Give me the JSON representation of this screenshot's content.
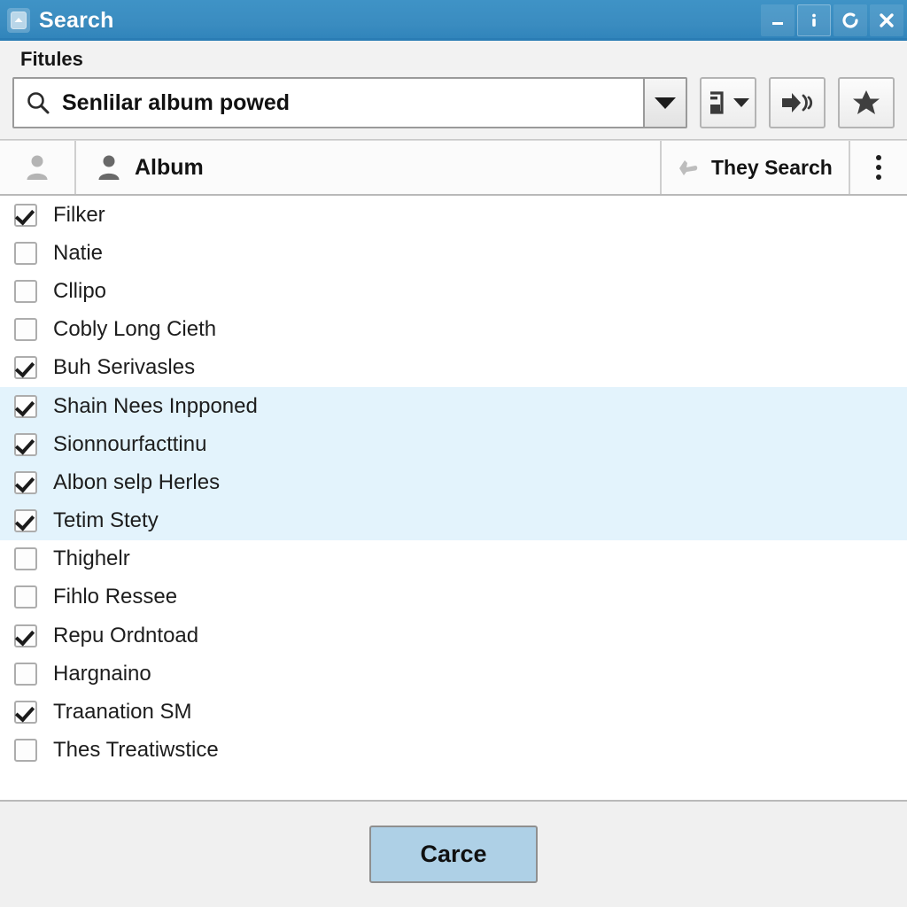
{
  "titlebar": {
    "app_icon": "chevron-up-app-icon",
    "title": "Search",
    "buttons": [
      {
        "name": "minimize-button",
        "icon": "minimize-icon"
      },
      {
        "name": "info-button",
        "icon": "info-icon"
      },
      {
        "name": "refresh-button",
        "icon": "refresh-icon"
      },
      {
        "name": "close-button",
        "icon": "close-icon"
      }
    ],
    "bg_color": "#3a8cc0"
  },
  "search_panel": {
    "label": "Fitules",
    "search_icon": "search-icon",
    "query_value": "Senlilar album powed",
    "query_placeholder": "Senlilar album powed",
    "dropdown_icon": "chevron-down-icon",
    "tools": [
      {
        "name": "list-options-button",
        "icon": "list-icon"
      },
      {
        "name": "playback-button",
        "icon": "arrow-sound-icon"
      },
      {
        "name": "favorite-button",
        "icon": "star-icon"
      }
    ]
  },
  "header": {
    "icon_column_icon": "person-icon",
    "album_icon": "person-icon",
    "album_label": "Album",
    "they_search_icon": "hand-pointer-icon",
    "they_search_label": "They Search",
    "menu_icon": "kebab-menu-icon"
  },
  "list": {
    "highlight_color": "#e3f3fc",
    "items": [
      {
        "label": "Filker",
        "checked": true,
        "selected": false
      },
      {
        "label": "Natie",
        "checked": false,
        "selected": false
      },
      {
        "label": "Cllipo",
        "checked": false,
        "selected": false
      },
      {
        "label": "Cobly Long Cieth",
        "checked": false,
        "selected": false
      },
      {
        "label": "Buh Serivasles",
        "checked": true,
        "selected": false
      },
      {
        "label": "Shain Nees Inpponed",
        "checked": true,
        "selected": true
      },
      {
        "label": "Sionnourfacttinu",
        "checked": true,
        "selected": true
      },
      {
        "label": "Albon selp Herles",
        "checked": true,
        "selected": true
      },
      {
        "label": "Tetim Stety",
        "checked": true,
        "selected": true
      },
      {
        "label": "Thighelr",
        "checked": false,
        "selected": false
      },
      {
        "label": "Fihlo Ressee",
        "checked": false,
        "selected": false
      },
      {
        "label": "Repu Ordntoad",
        "checked": true,
        "selected": false
      },
      {
        "label": "Hargnaino",
        "checked": false,
        "selected": false
      },
      {
        "label": "Traanation SM",
        "checked": true,
        "selected": false
      },
      {
        "label": "Thes Treatiwstice",
        "checked": false,
        "selected": false
      }
    ]
  },
  "footer": {
    "cancel_label": "Carce",
    "cancel_color": "#aed0e6"
  }
}
